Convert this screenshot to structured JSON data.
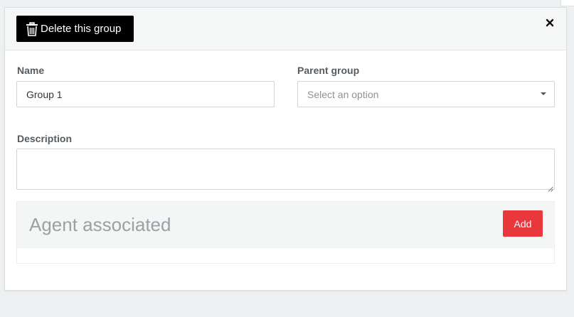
{
  "header": {
    "delete_label": "Delete this group",
    "delete_icon": "trash-icon",
    "close_icon": "close-icon"
  },
  "form": {
    "name": {
      "label": "Name",
      "value": "Group 1"
    },
    "parent_group": {
      "label": "Parent group",
      "placeholder": "Select an option"
    },
    "description": {
      "label": "Description",
      "value": ""
    }
  },
  "agents": {
    "title": "Agent associated",
    "add_label": "Add"
  },
  "colors": {
    "delete_button_bg": "#000000",
    "add_button_bg": "#e8383e",
    "page_bg": "#eef0f1",
    "label_text": "#555c61",
    "muted_title": "#9aa2a6"
  }
}
